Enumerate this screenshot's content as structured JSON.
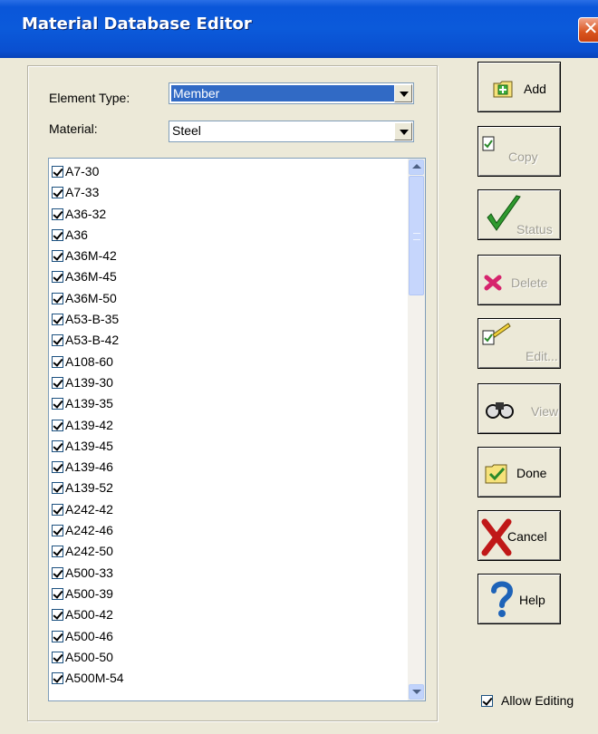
{
  "window": {
    "title": "Material Database Editor",
    "close_symbol": "✕"
  },
  "form": {
    "element_type_label": "Element Type:",
    "element_type_value": "Member",
    "material_label": "Material:",
    "material_value": "Steel"
  },
  "materials": [
    "A7-30",
    "A7-33",
    "A36-32",
    "A36",
    "A36M-42",
    "A36M-45",
    "A36M-50",
    "A53-B-35",
    "A53-B-42",
    "A108-60",
    "A139-30",
    "A139-35",
    "A139-42",
    "A139-45",
    "A139-46",
    "A139-52",
    "A242-42",
    "A242-46",
    "A242-50",
    "A500-33",
    "A500-39",
    "A500-42",
    "A500-46",
    "A500-50",
    "A500M-54"
  ],
  "buttons": {
    "add": "Add",
    "copy": "Copy",
    "status": "Status",
    "delete": "Delete",
    "edit": "Edit...",
    "view": "View",
    "done": "Done",
    "cancel": "Cancel",
    "help": "Help"
  },
  "allow_editing": {
    "label": "Allow Editing",
    "checked": true
  },
  "icons": [
    "add-icon",
    "copy-icon",
    "status-check-icon",
    "delete-x-icon",
    "edit-pencil-icon",
    "view-binoculars-icon",
    "done-icon",
    "cancel-x-icon",
    "help-question-icon"
  ]
}
